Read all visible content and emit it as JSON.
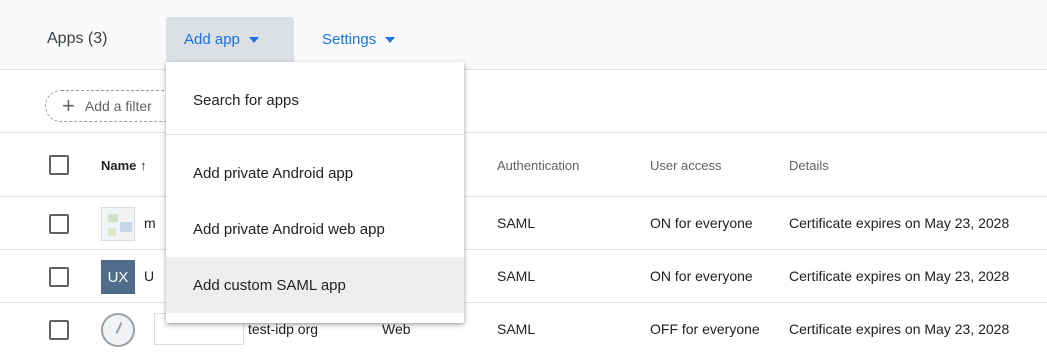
{
  "header": {
    "title": "Apps (3)",
    "add_app_label": "Add app",
    "settings_label": "Settings"
  },
  "filter": {
    "label": "Add a filter"
  },
  "table": {
    "columns": {
      "name": "Name ↑",
      "authentication": "Authentication",
      "user_access": "User access",
      "details": "Details"
    },
    "rows": [
      {
        "name": "m",
        "authentication": "SAML",
        "user_access": "ON for everyone",
        "details": "Certificate expires on May 23, 2028"
      },
      {
        "thumb_text": "UX",
        "name": "U",
        "authentication": "SAML",
        "user_access": "ON for everyone",
        "details": "Certificate expires on May 23, 2028"
      },
      {
        "name": "test-idp org",
        "type": "Web",
        "authentication": "SAML",
        "user_access": "OFF for everyone",
        "details": "Certificate expires on May 23, 2028"
      }
    ]
  },
  "menu": {
    "items": [
      {
        "label": "Search for apps"
      },
      {
        "label": "Add private Android app"
      },
      {
        "label": "Add private Android web app"
      },
      {
        "label": "Add custom SAML app"
      }
    ]
  },
  "colors": {
    "accent": "#1a73e8",
    "header_bg": "#f8f9fa",
    "active_button_bg": "#dcdfe3",
    "hover_bg": "#eeeeee"
  },
  "icons": [
    "plus-icon",
    "caret-down-icon",
    "sort-arrow-up-icon",
    "app-thumbnail-icon",
    "clock-icon"
  ]
}
